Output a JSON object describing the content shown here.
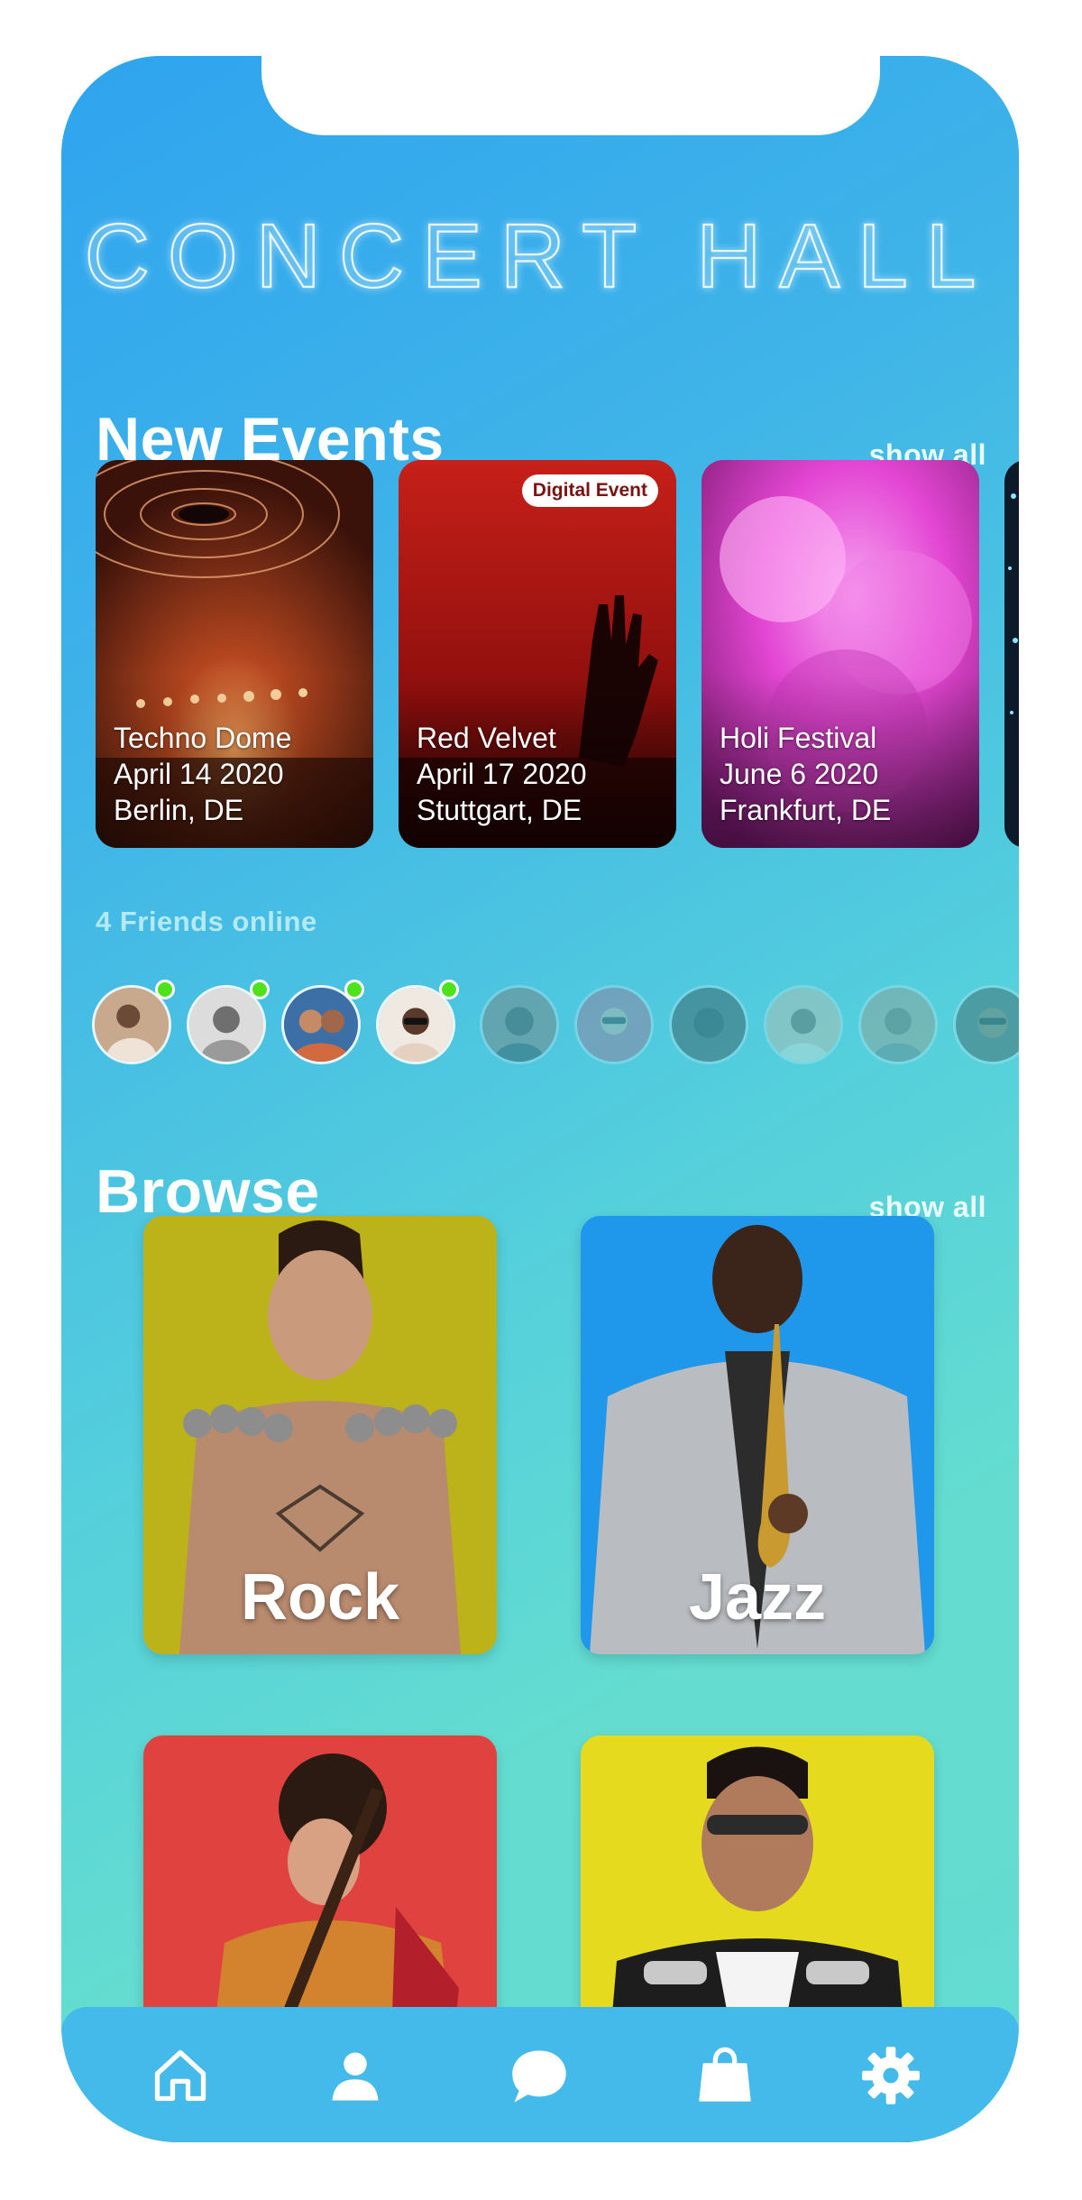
{
  "app": {
    "logo_text": "CONCERT HALL",
    "colors": {
      "accent_gradient_start": "#2fa4ef",
      "accent_gradient_end": "#63dcd1",
      "online": "#4ee21d",
      "tabbar": "#43bae9"
    }
  },
  "new_events": {
    "title": "New Events",
    "show_all": "show all",
    "events": [
      {
        "name": "Techno Dome",
        "date": "April 14 2020",
        "location": "Berlin, DE"
      },
      {
        "name": "Red Velvet",
        "date": "April 17 2020",
        "location": "Stuttgart, DE",
        "badge": "Digital Event"
      },
      {
        "name": "Holi Festival",
        "date": "June 6 2020",
        "location": "Frankfurt, DE"
      }
    ]
  },
  "friends": {
    "label": "4 Friends online",
    "online_count": 4,
    "avatars_shown": 10
  },
  "browse": {
    "title": "Browse",
    "show_all": "show all",
    "genres": [
      {
        "label": "Rock"
      },
      {
        "label": "Jazz"
      },
      {
        "label": ""
      },
      {
        "label": ""
      }
    ]
  },
  "tabbar": {
    "icons": [
      "home-icon",
      "profile-icon",
      "chat-icon",
      "shopping-bag-icon",
      "settings-gear-icon"
    ]
  }
}
